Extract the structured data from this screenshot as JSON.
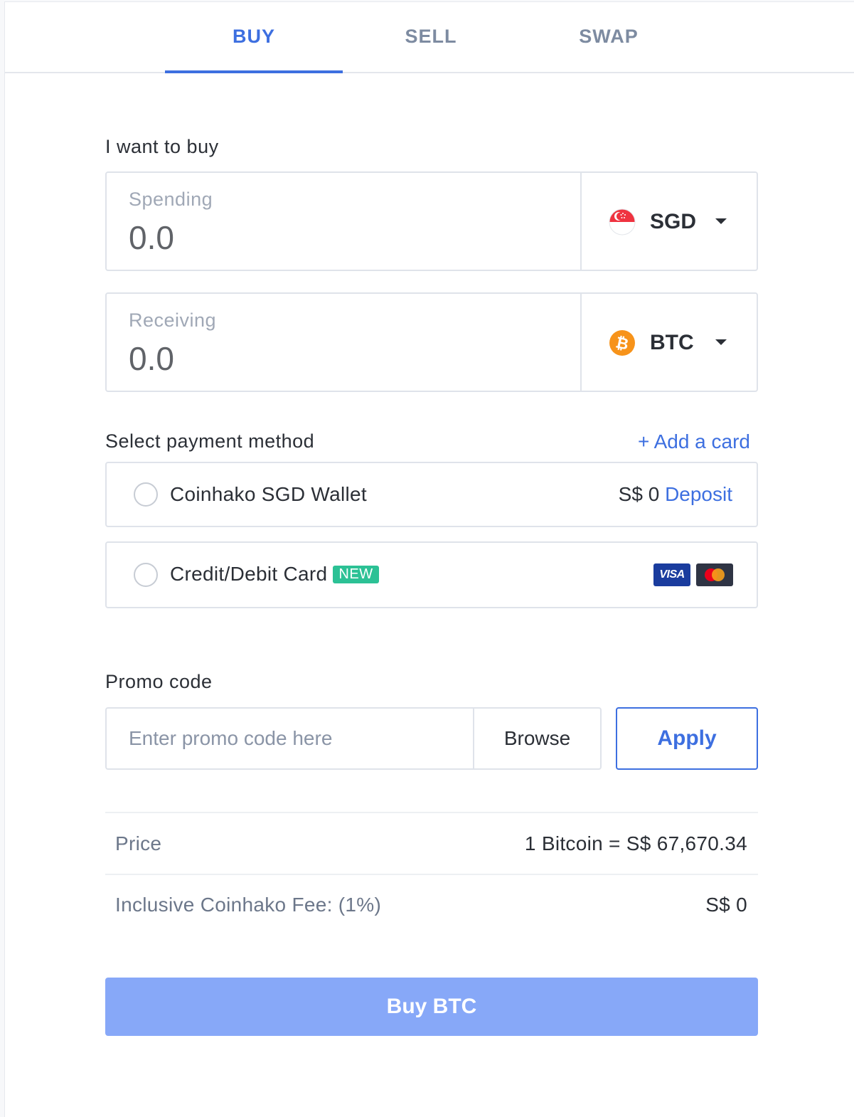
{
  "tabs": [
    {
      "label": "BUY",
      "active": true
    },
    {
      "label": "SELL",
      "active": false
    },
    {
      "label": "SWAP",
      "active": false
    }
  ],
  "buy_section": {
    "title": "I want to buy",
    "spending": {
      "label": "Spending",
      "value": "0.0",
      "currency": "SGD",
      "icon": "singapore-flag-icon"
    },
    "receiving": {
      "label": "Receiving",
      "value": "0.0",
      "currency": "BTC",
      "icon": "bitcoin-icon"
    }
  },
  "payment": {
    "title": "Select payment method",
    "add_card": "+ Add a card",
    "options": [
      {
        "name": "Coinhako SGD Wallet",
        "balance": "S$ 0",
        "action": "Deposit",
        "selected": false
      },
      {
        "name": "Credit/Debit Card",
        "badge": "NEW",
        "selected": false,
        "logos": [
          "VISA",
          "mastercard"
        ]
      }
    ]
  },
  "promo": {
    "title": "Promo code",
    "placeholder": "Enter promo code here",
    "value": "",
    "browse_label": "Browse",
    "apply_label": "Apply"
  },
  "summary": {
    "price_label": "Price",
    "price_value": "1 Bitcoin = S$ 67,670.34",
    "fee_label": "Inclusive Coinhako Fee: (1%)",
    "fee_value": "S$ 0"
  },
  "submit": {
    "label": "Buy BTC",
    "enabled": false
  },
  "colors": {
    "accent": "#3d6fe0",
    "disabled_button": "#87a8f8",
    "new_badge": "#2cc195",
    "bitcoin": "#f7931a"
  }
}
